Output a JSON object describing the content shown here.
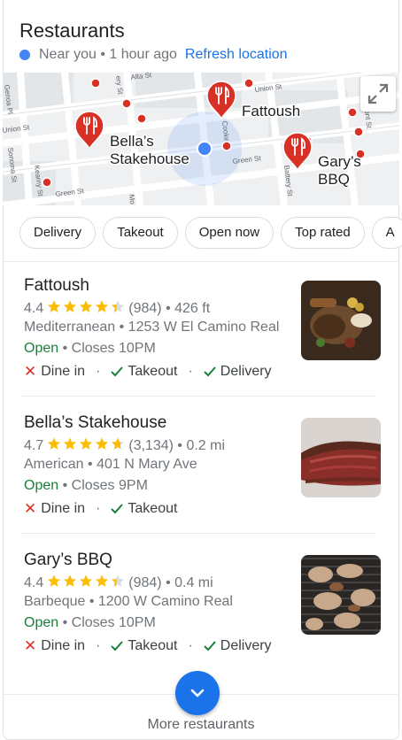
{
  "header": {
    "title": "Restaurants",
    "location_text": "Near you • 1 hour ago",
    "refresh_label": "Refresh location"
  },
  "map": {
    "street_labels": [
      "Alta St",
      "Union St",
      "Front St",
      "Genoa Pl",
      "Sonoma St",
      "Kearny St",
      "Green St",
      "Green St",
      "Union St",
      "Cooke St",
      "Mo",
      "ery St",
      "Battery St",
      "Fort St",
      "Montgomery St"
    ],
    "pins": [
      {
        "label_line1": "Fattoush",
        "label_line2": ""
      },
      {
        "label_line1": "Bella’s",
        "label_line2": "Stakehouse"
      },
      {
        "label_line1": "Gary’s",
        "label_line2": "BBQ"
      }
    ]
  },
  "filters": [
    "Delivery",
    "Takeout",
    "Open now",
    "Top rated",
    "A"
  ],
  "results": [
    {
      "name": "Fattoush",
      "rating": "4.4",
      "rating_value": 4.4,
      "reviews": "(984)",
      "distance": "• 426 ft",
      "category_address": "Mediterranean • 1253 W El Camino Real",
      "status": "Open",
      "hours": "• Closes 10PM",
      "services": [
        {
          "label": "Dine in",
          "available": false
        },
        {
          "label": "Takeout",
          "available": true
        },
        {
          "label": "Delivery",
          "available": true
        }
      ],
      "photo": "grilled-meat-platter"
    },
    {
      "name": "Bella’s Stakehouse",
      "rating": "4.7",
      "rating_value": 4.7,
      "reviews": "(3,134)",
      "distance": "• 0.2 mi",
      "category_address": "American • 401 N Mary Ave",
      "status": "Open",
      "hours": "• Closes 9PM",
      "services": [
        {
          "label": "Dine in",
          "available": false
        },
        {
          "label": "Takeout",
          "available": true
        }
      ],
      "photo": "sliced-steak"
    },
    {
      "name": "Gary’s BBQ",
      "rating": "4.4",
      "rating_value": 4.4,
      "reviews": "(984)",
      "distance": "• 0.4 mi",
      "category_address": "Barbeque • 1200 W Camino Real",
      "status": "Open",
      "hours": "• Closes 10PM",
      "services": [
        {
          "label": "Dine in",
          "available": false
        },
        {
          "label": "Takeout",
          "available": true
        },
        {
          "label": "Delivery",
          "available": true
        }
      ],
      "photo": "bbq-grill"
    }
  ],
  "more_label": "More restaurants",
  "colors": {
    "accent": "#1a73e8",
    "pin": "#d93025",
    "star": "#fbbc04",
    "open": "#188038",
    "check": "#188038",
    "cross": "#d93025"
  }
}
